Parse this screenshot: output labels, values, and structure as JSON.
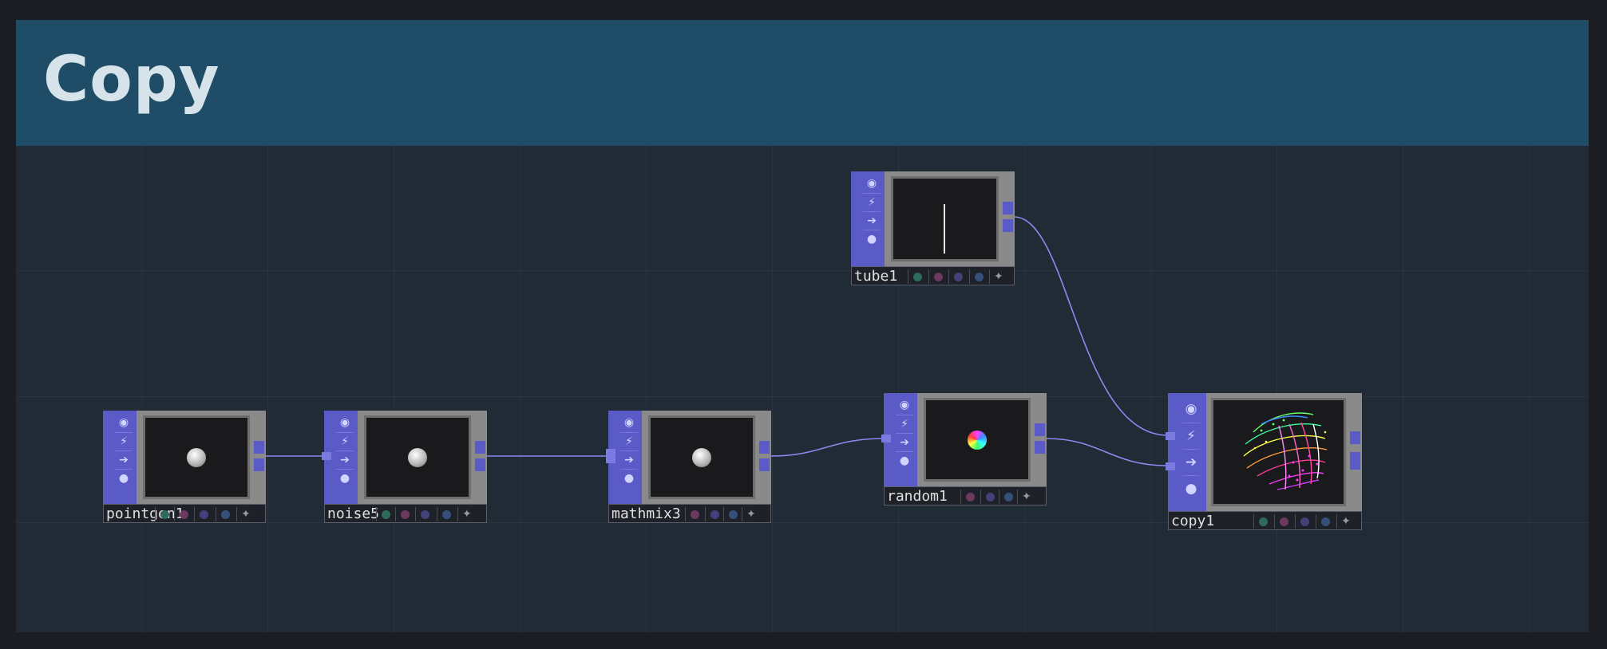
{
  "page": {
    "title": "Copy"
  },
  "colors": {
    "header": "#1f4d68",
    "background": "#212b35",
    "node_strip": "#5b5bc8",
    "wire": "#8a8af0"
  },
  "nodes": [
    {
      "label": "pointgen1",
      "preview": "white-sphere"
    },
    {
      "label": "noise5",
      "preview": "white-sphere"
    },
    {
      "label": "mathmix3",
      "preview": "white-sphere"
    },
    {
      "label": "random1",
      "preview": "colored-sphere"
    },
    {
      "label": "tube1",
      "preview": "vertical-line"
    },
    {
      "label": "copy1",
      "preview": "colored-point-cloud"
    }
  ],
  "node_strip_icons": [
    "viewer-toggle-icon",
    "cook-icon",
    "bypass-arrow-icon",
    "lock-icon"
  ],
  "flag_icons": [
    "display-flag-icon",
    "render-flag-icon",
    "template-flag-icon",
    "selectable-flag-icon",
    "pin-icon"
  ],
  "flag_colors": [
    "#2f6b5a",
    "#6b3a5e",
    "#43417a",
    "#35507a",
    "#999999"
  ]
}
